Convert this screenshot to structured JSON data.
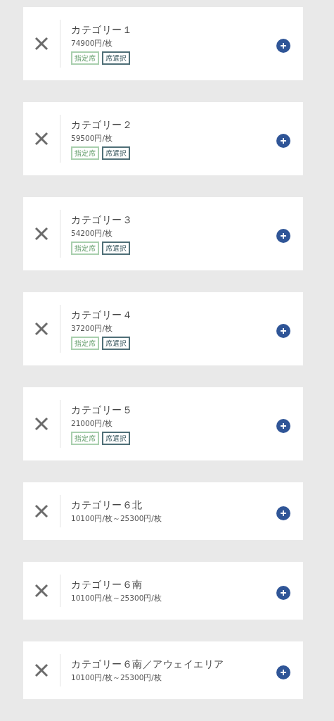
{
  "items": [
    {
      "name": "カテゴリー１",
      "price": "74900円/枚",
      "tags": [
        {
          "label": "指定席",
          "kind": "reserved"
        },
        {
          "label": "席選択",
          "kind": "select"
        }
      ]
    },
    {
      "name": "カテゴリー２",
      "price": "59500円/枚",
      "tags": [
        {
          "label": "指定席",
          "kind": "reserved"
        },
        {
          "label": "席選択",
          "kind": "select"
        }
      ]
    },
    {
      "name": "カテゴリー３",
      "price": "54200円/枚",
      "tags": [
        {
          "label": "指定席",
          "kind": "reserved"
        },
        {
          "label": "席選択",
          "kind": "select"
        }
      ]
    },
    {
      "name": "カテゴリー４",
      "price": "37200円/枚",
      "tags": [
        {
          "label": "指定席",
          "kind": "reserved"
        },
        {
          "label": "席選択",
          "kind": "select"
        }
      ]
    },
    {
      "name": "カテゴリー５",
      "price": "21000円/枚",
      "tags": [
        {
          "label": "指定席",
          "kind": "reserved"
        },
        {
          "label": "席選択",
          "kind": "select"
        }
      ]
    },
    {
      "name": "カテゴリー６北",
      "price": "10100円/枚～25300円/枚"
    },
    {
      "name": "カテゴリー６南",
      "price": "10100円/枚～25300円/枚"
    },
    {
      "name": "カテゴリー６南／アウェイエリア",
      "price": "10100円/枚～25300円/枚"
    }
  ]
}
